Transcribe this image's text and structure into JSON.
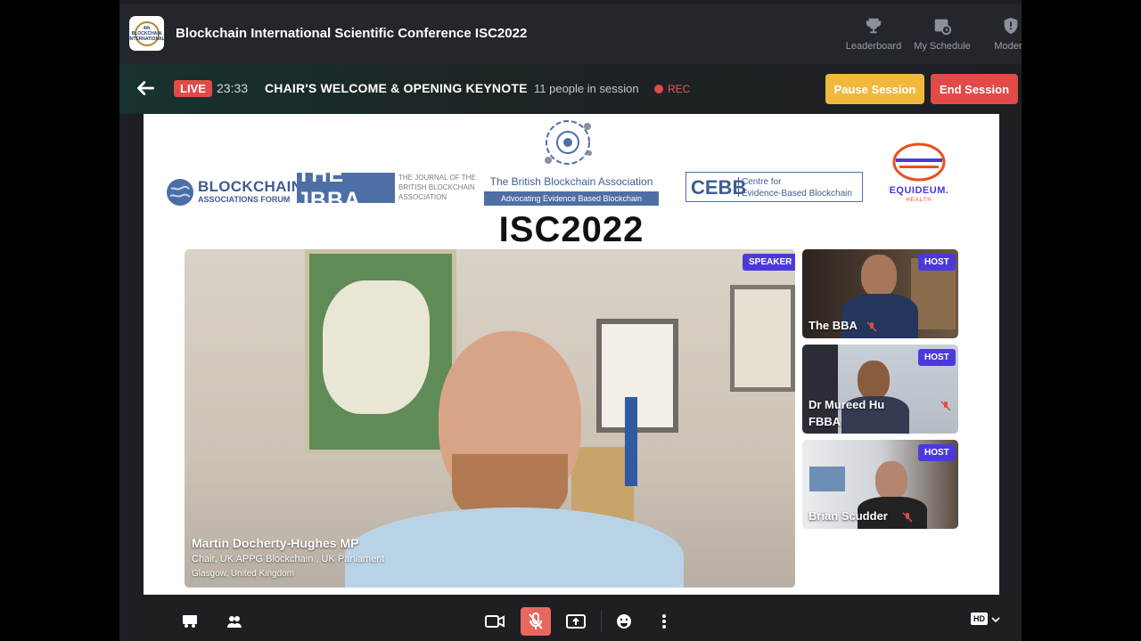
{
  "app": {
    "title": "Blockchain International Scientific Conference ISC2022",
    "logo_text": "4th BLOCKCHAIN INTERNATIONAL",
    "nav": [
      {
        "label": "Leaderboard",
        "icon": "trophy-icon"
      },
      {
        "label": "My Schedule",
        "icon": "calendar-clock-icon"
      },
      {
        "label": "Modera",
        "icon": "shield-icon"
      }
    ]
  },
  "session": {
    "live_label": "LIVE",
    "timer": "23:33",
    "title": "CHAIR'S WELCOME & OPENING KEYNOTE",
    "people": "11 people in session",
    "rec_label": "REC",
    "pause_label": "Pause Session",
    "end_label": "End Session"
  },
  "stage": {
    "logos": {
      "baf_line1": "BLOCKCHAIN",
      "baf_line2": "ASSOCIATIONS FORUM",
      "jbba_main": "THE JBBA",
      "jbba_sub1": "THE JOURNAL OF THE",
      "jbba_sub2": "BRITISH BLOCKCHAIN",
      "jbba_sub3": "ASSOCIATION",
      "bba_name": "The British Blockchain Association",
      "bba_tagline": "Advocating Evidence Based Blockchain",
      "cebb_main": "CEBB",
      "cebb_sub1": "Centre for",
      "cebb_sub2": "Evidence-Based Blockchain",
      "equideum": "EQUIDEUM.",
      "equideum_sub": "HEALTH"
    },
    "event_name": "ISC2022",
    "speaker": {
      "badge": "SPEAKER",
      "name": "Martin Docherty-Hughes MP",
      "role": "Chair, UK APPG Blockchain , UK Parliament",
      "location": "Glasgow, United Kingdom"
    },
    "participants": [
      {
        "badge": "HOST",
        "name": "The BBA"
      },
      {
        "badge": "HOST",
        "name": "Dr Mureed Hu",
        "name2": "FBBA"
      },
      {
        "badge": "HOST",
        "name": "Brian Scudder"
      }
    ]
  },
  "controls": {
    "icons": [
      "breakout-rooms-icon",
      "participants-icon",
      "camera-icon",
      "mic-off-icon",
      "share-screen-icon",
      "emoji-icon",
      "more-icon"
    ],
    "quality": "HD"
  },
  "colors": {
    "accent_live": "#e24a48",
    "pause": "#f0b93e",
    "badge": "#4b3adb",
    "bba_blue": "#3d5d93",
    "equideum": "#e8501e"
  }
}
